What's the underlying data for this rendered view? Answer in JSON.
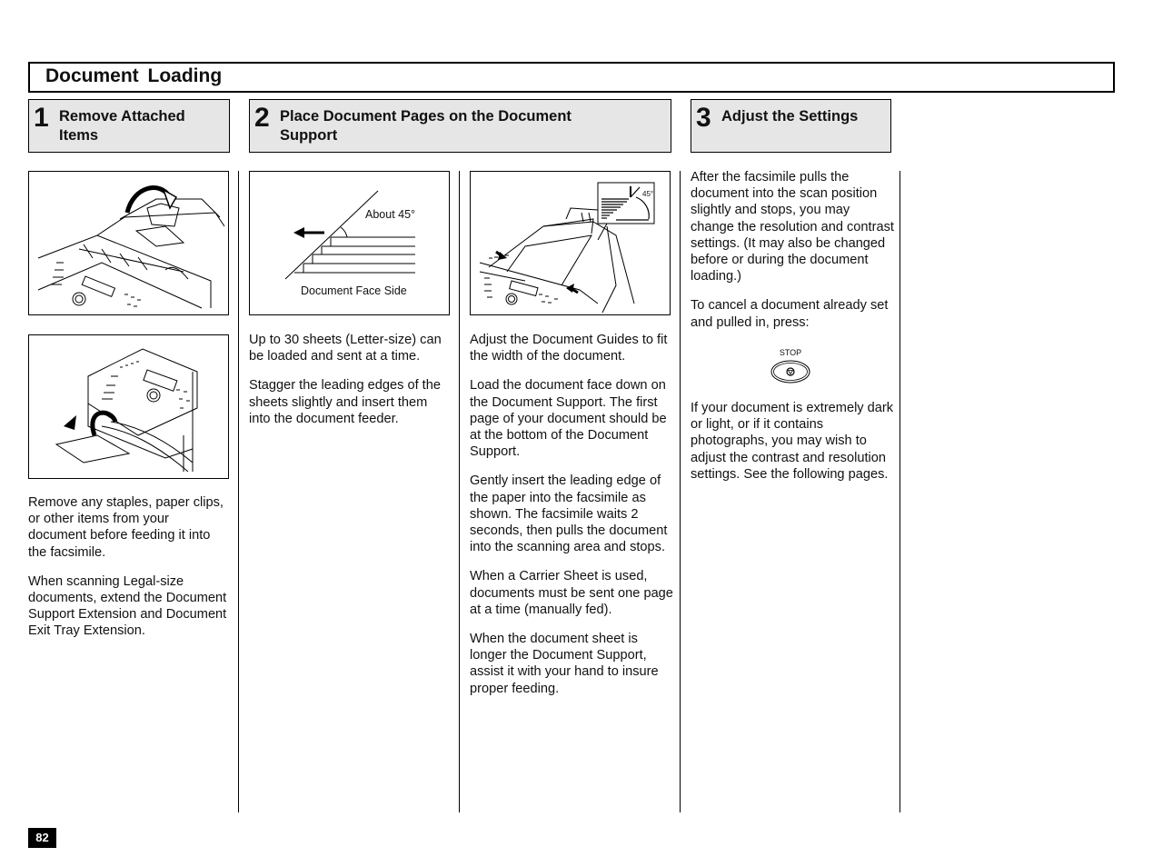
{
  "page": {
    "title": "Document Loading",
    "page_number": "82"
  },
  "steps": [
    {
      "number": "1",
      "label": "Remove Attached Items"
    },
    {
      "number": "2",
      "label": "Place Document Pages on the Document Support"
    },
    {
      "number": "3",
      "label": "Adjust the Settings"
    }
  ],
  "figures": {
    "stagger_diagram": {
      "angle_label": "About 45°",
      "face_label": "Document Face Side"
    },
    "guides_inset": {
      "angle_label": "45°"
    },
    "stop_button": {
      "label": "STOP"
    }
  },
  "columns": {
    "col1": [
      "Remove any staples, paper clips, or other items from your document before feeding it into the facsimile.",
      "When scanning Legal-size documents, extend the Document Support Extension and Document Exit Tray Extension."
    ],
    "col2": [
      "Up to 30 sheets (Letter-size) can be loaded and sent at a time.",
      "Stagger the leading edges of the sheets slightly and insert them into the document feeder."
    ],
    "col3": [
      "Adjust the Document Guides to fit the width of the document.",
      "Load the document face down on the Document Support. The first page of your document should be at the bottom of the Document Support.",
      "Gently insert the leading edge of the paper into the facsimile as shown. The facsimile waits 2 seconds, then pulls the document into the scanning area and stops.",
      "When a Carrier Sheet is used, documents must be sent one page at a time (manually fed).",
      "When the document sheet is longer the Document Support, assist it with your hand to insure proper feeding."
    ],
    "col4_before": [
      "After the facsimile pulls the document into the scan position slightly and stops, you may change the resolution and contrast settings. (It may also be changed before or during the document loading.)",
      "To cancel a document already set and pulled in, press:"
    ],
    "col4_after": [
      "If your document is extremely dark or light, or if it contains photographs, you may wish to adjust the contrast and resolution settings.  See the following pages."
    ]
  }
}
